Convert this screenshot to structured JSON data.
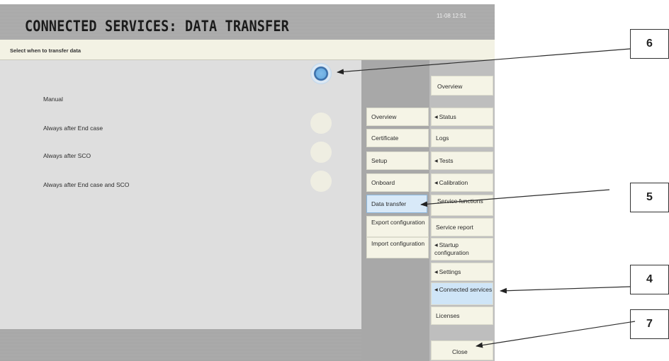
{
  "header": {
    "title": "CONNECTED SERVICES: DATA TRANSFER",
    "datetime": "11-08  12:51"
  },
  "subheader": {
    "text": "Select when to transfer data"
  },
  "options": [
    {
      "label": "Manual",
      "selected": true
    },
    {
      "label": "Always after End case",
      "selected": false
    },
    {
      "label": "Always after SCO",
      "selected": false
    },
    {
      "label": "Always after End case and SCO",
      "selected": false
    }
  ],
  "subtabs": [
    {
      "label": "Overview"
    },
    {
      "label": "Certificate"
    },
    {
      "label": "Setup"
    },
    {
      "label": "Onboard"
    },
    {
      "label": "Data transfer",
      "selected": true
    },
    {
      "label": "Export configuration"
    },
    {
      "label": "Import configuration"
    }
  ],
  "maintabs": [
    {
      "label": "Overview"
    },
    {
      "label": "Status",
      "submenu": true
    },
    {
      "label": "Logs"
    },
    {
      "label": "Tests",
      "submenu": true
    },
    {
      "label": "Calibration",
      "submenu": true
    },
    {
      "label": "Service functions"
    },
    {
      "label": "Service report"
    },
    {
      "label": "Startup configuration",
      "submenu": true
    },
    {
      "label": "Settings",
      "submenu": true
    },
    {
      "label": "Connected services",
      "submenu": true,
      "selected": true
    },
    {
      "label": "Licenses"
    }
  ],
  "close_button": {
    "label": "Close"
  },
  "callouts": [
    {
      "label": "6"
    },
    {
      "label": "5"
    },
    {
      "label": "4"
    },
    {
      "label": "7"
    }
  ],
  "colors": {
    "selected_tab": "#d8e9f8",
    "radio_on": "#6caee2",
    "panel": "#dedede",
    "cream": "#f5f4e6"
  }
}
